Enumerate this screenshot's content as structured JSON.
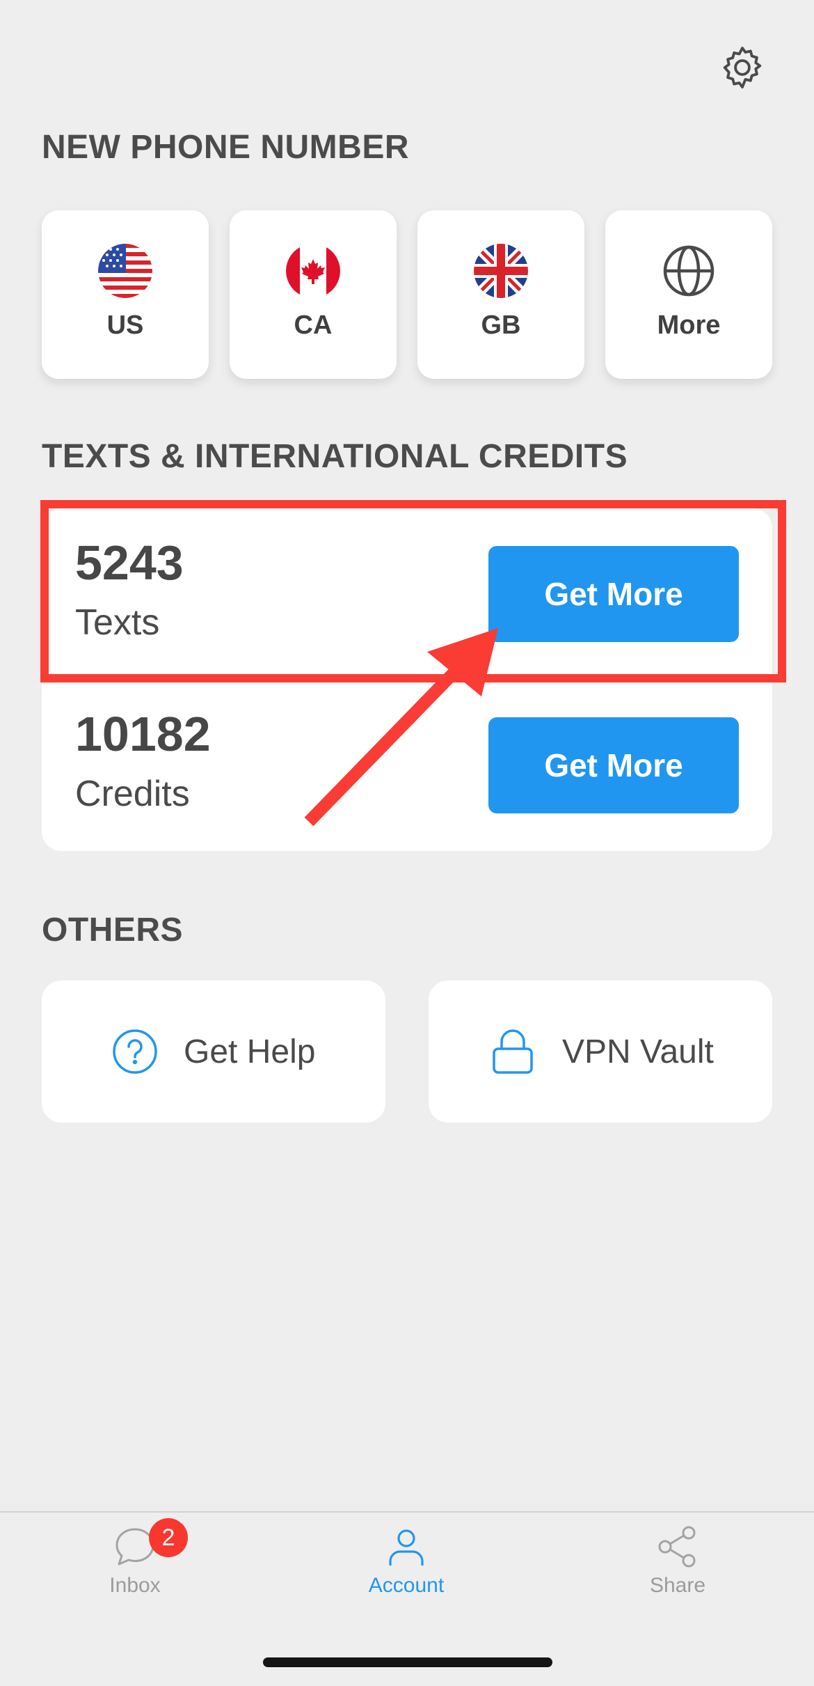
{
  "sections": {
    "new_number_title": "NEW PHONE NUMBER",
    "credits_title": "TEXTS & INTERNATIONAL CREDITS",
    "others_title": "OTHERS"
  },
  "countries": [
    {
      "code": "US",
      "icon": "us-flag-icon"
    },
    {
      "code": "CA",
      "icon": "ca-flag-icon"
    },
    {
      "code": "GB",
      "icon": "gb-flag-icon"
    },
    {
      "code": "More",
      "icon": "globe-icon"
    }
  ],
  "balances": {
    "texts": {
      "count": "5243",
      "label": "Texts",
      "button": "Get More"
    },
    "credits": {
      "count": "10182",
      "label": "Credits",
      "button": "Get More"
    }
  },
  "others": {
    "help_label": "Get Help",
    "vpn_label": "VPN Vault"
  },
  "tabbar": {
    "inbox_label": "Inbox",
    "inbox_badge": "2",
    "account_label": "Account",
    "share_label": "Share"
  },
  "colors": {
    "accent": "#2196f0",
    "highlight": "#fa3c34",
    "badge": "#f8372f"
  }
}
